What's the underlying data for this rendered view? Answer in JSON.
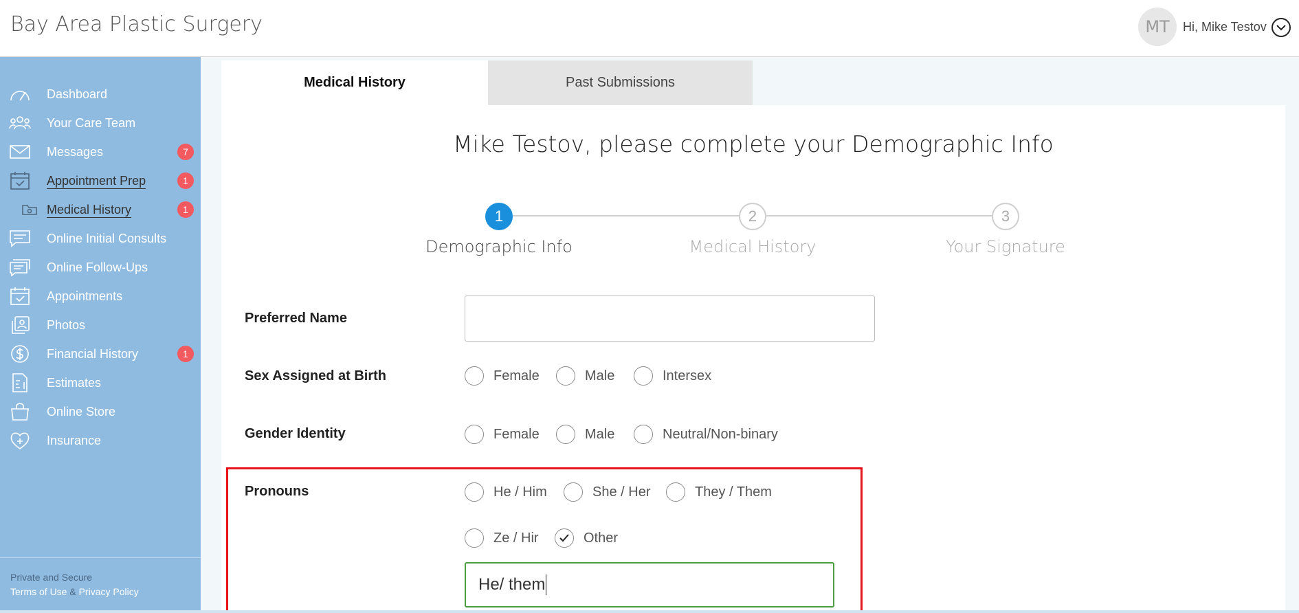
{
  "header": {
    "brand": "Bay Area Plastic Surgery",
    "avatar_initials": "MT",
    "greeting": "Hi, Mike Testov",
    "menu_icon": "chevron-down-circle-icon"
  },
  "sidebar": {
    "items": [
      {
        "label": "Dashboard",
        "icon": "gauge-icon",
        "badge": ""
      },
      {
        "label": "Your Care Team",
        "icon": "people-icon",
        "badge": ""
      },
      {
        "label": "Messages",
        "icon": "envelope-icon",
        "badge": "7"
      },
      {
        "label": "Appointment Prep",
        "icon": "calendar-check-icon",
        "badge": "1"
      },
      {
        "label": "Medical History",
        "icon": "folder-icon",
        "badge": "1"
      },
      {
        "label": "Online Initial Consults",
        "icon": "chat-lines-icon",
        "badge": ""
      },
      {
        "label": "Online Follow-Ups",
        "icon": "chat-stack-icon",
        "badge": ""
      },
      {
        "label": "Appointments",
        "icon": "calendar-icon",
        "badge": ""
      },
      {
        "label": "Photos",
        "icon": "photos-icon",
        "badge": ""
      },
      {
        "label": "Financial History",
        "icon": "dollar-icon",
        "badge": "1"
      },
      {
        "label": "Estimates",
        "icon": "document-dollar-icon",
        "badge": ""
      },
      {
        "label": "Online Store",
        "icon": "shopping-bag-icon",
        "badge": ""
      },
      {
        "label": "Insurance",
        "icon": "heart-plus-icon",
        "badge": ""
      }
    ],
    "footer": {
      "private": "Private and Secure",
      "terms": "Terms of Use",
      "amp": "&",
      "privacy": "Privacy Policy"
    }
  },
  "tabs": [
    {
      "label": "Medical History"
    },
    {
      "label": "Past Submissions"
    }
  ],
  "page": {
    "title": "Mike Testov, please complete your Demographic Info"
  },
  "stepper": {
    "steps": [
      {
        "number": "1",
        "label": "Demographic Info"
      },
      {
        "number": "2",
        "label": "Medical History"
      },
      {
        "number": "3",
        "label": "Your Signature"
      }
    ],
    "current": 1
  },
  "form": {
    "preferred_name": {
      "label": "Preferred Name",
      "value": ""
    },
    "sex_at_birth": {
      "label": "Sex Assigned at Birth",
      "options": [
        "Female",
        "Male",
        "Intersex"
      ]
    },
    "gender_identity": {
      "label": "Gender Identity",
      "options": [
        "Female",
        "Male",
        "Neutral/Non-binary"
      ]
    },
    "pronouns": {
      "label": "Pronouns",
      "options": [
        "He / Him",
        "She / Her",
        "They / Them",
        "Ze / Hir",
        "Other"
      ],
      "selected": "Other",
      "other_value": "He/ them"
    }
  },
  "colors": {
    "sidebar": "#8fbbe0",
    "badge": "#f25a5f",
    "step_active": "#1a8fdb",
    "highlight": "#e8141c",
    "focus_border": "#4a9e3f"
  }
}
